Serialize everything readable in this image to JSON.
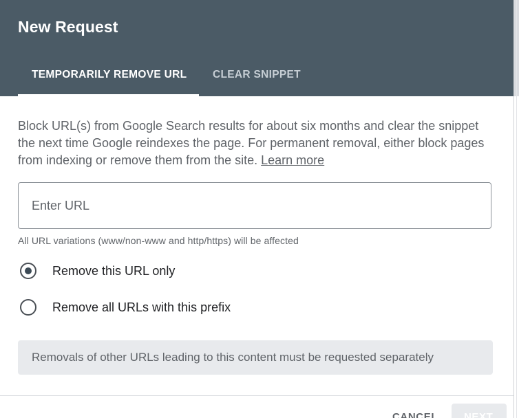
{
  "dialog": {
    "title": "New Request"
  },
  "tabs": [
    {
      "label": "TEMPORARILY REMOVE URL",
      "selected": true
    },
    {
      "label": "CLEAR SNIPPET",
      "selected": false
    }
  ],
  "description": {
    "text": "Block URL(s) from Google Search results for about six months and clear the snippet the next time Google reindexes the page. For permanent removal, either block pages from indexing or remove them from the site. ",
    "link": "Learn more"
  },
  "url_input": {
    "placeholder": "Enter URL",
    "value": "",
    "helper": "All URL variations (www/non-www and http/https) will be affected"
  },
  "radio_options": [
    {
      "label": "Remove this URL only",
      "selected": true
    },
    {
      "label": "Remove all URLs with this prefix",
      "selected": false
    }
  ],
  "notice": {
    "text": "Removals of other URLs leading to this content must be requested separately"
  },
  "footer": {
    "cancel_label": "CANCEL",
    "next_label": "NEXT",
    "next_enabled": false
  },
  "colors": {
    "header_bg": "#4b5b66",
    "notice_bg": "#e8eaed",
    "text_secondary": "#5f6368",
    "text_primary": "#202124"
  },
  "icons": {
    "radio_selected": "radio-checked-icon",
    "radio_unselected": "radio-unchecked-icon"
  }
}
